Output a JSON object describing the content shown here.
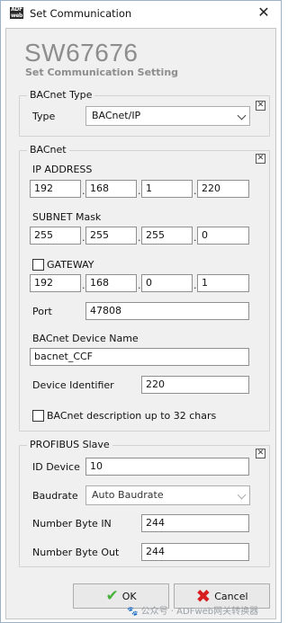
{
  "window": {
    "title": "Set Communication",
    "icon_text": "ADF web",
    "close_glyph": "✕"
  },
  "header": {
    "brand": "SW67676",
    "subtitle": "Set Communication Setting"
  },
  "bacnet_type": {
    "group_title": "BACnet Type",
    "toggle_glyph": "✕",
    "type_label": "Type",
    "type_value": "BACnet/IP"
  },
  "bacnet": {
    "group_title": "BACnet",
    "toggle_glyph": "✕",
    "ip_label": "IP ADDRESS",
    "ip": [
      "192",
      "168",
      "1",
      "220"
    ],
    "subnet_label": "SUBNET Mask",
    "subnet": [
      "255",
      "255",
      "255",
      "0"
    ],
    "gateway_label": "GATEWAY",
    "gateway_checked": false,
    "gateway": [
      "192",
      "168",
      "0",
      "1"
    ],
    "port_label": "Port",
    "port_value": "47808",
    "device_name_label": "BACnet Device Name",
    "device_name_value": "bacnet_CCF",
    "device_id_label": "Device Identifier",
    "device_id_value": "220",
    "desc32_label": "BACnet description up to 32 chars",
    "desc32_checked": false
  },
  "profibus": {
    "group_title": "PROFIBUS Slave",
    "toggle_glyph": "✕",
    "id_label": "ID Device",
    "id_value": "10",
    "baudrate_label": "Baudrate",
    "baudrate_value": "Auto Baudrate",
    "byte_in_label": "Number Byte IN",
    "byte_in_value": "244",
    "byte_out_label": "Number Byte Out",
    "byte_out_value": "244"
  },
  "buttons": {
    "ok_label": "OK",
    "ok_glyph": "✔",
    "cancel_label": "Cancel",
    "cancel_glyph": "✖"
  },
  "watermark": "🐾 公众号 · ADFweb网关转换器",
  "colors": {
    "ok_green": "#48b13c",
    "cancel_red": "#d71f1f",
    "brand_gray": "#8d8d8d",
    "dialog_bg": "#f0f0f0"
  }
}
